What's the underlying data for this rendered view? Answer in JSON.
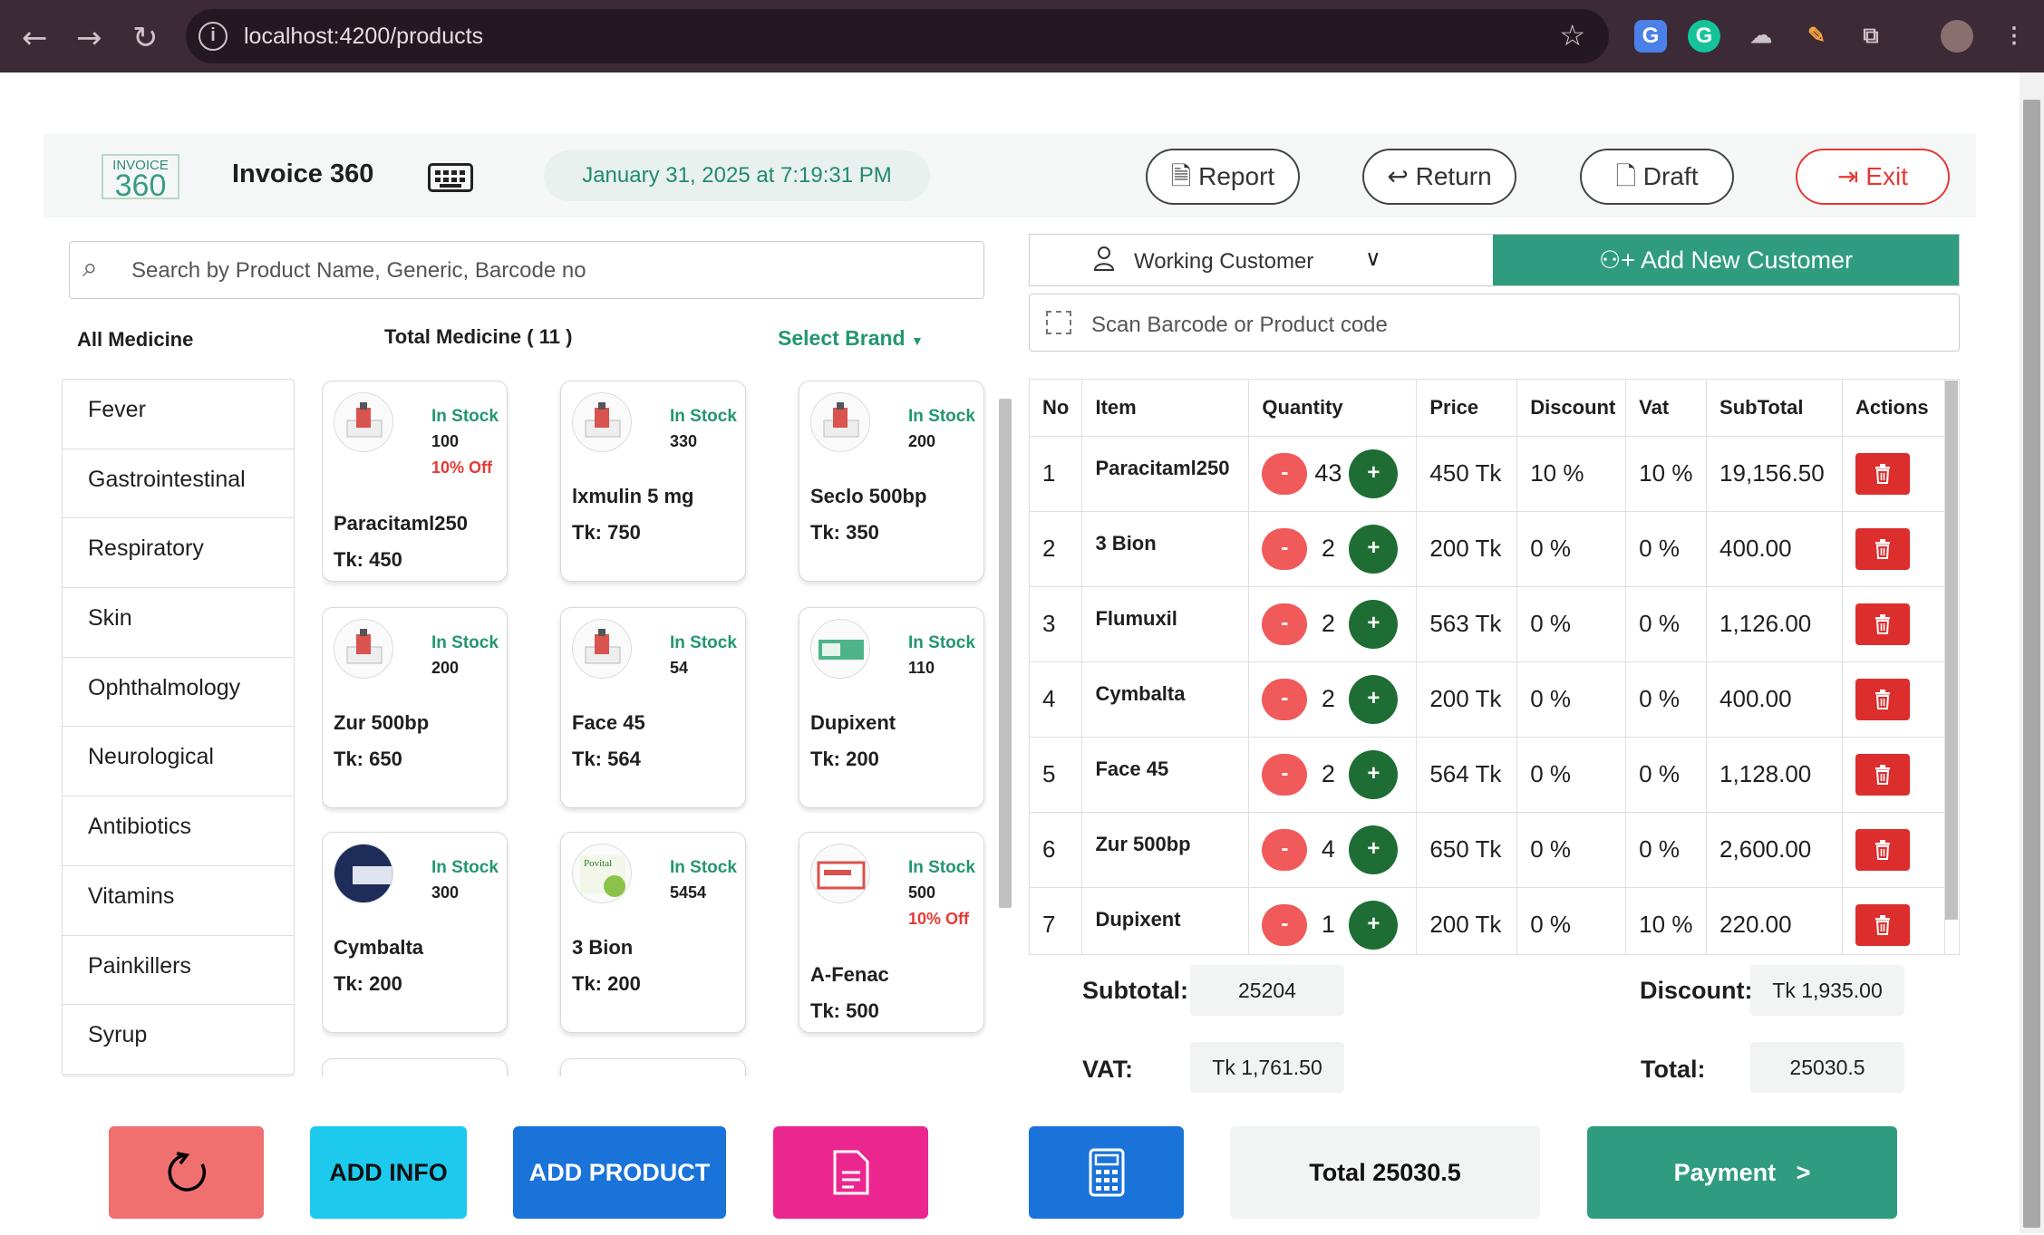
{
  "browser": {
    "url": "localhost:4200/products"
  },
  "header": {
    "logo_top": "INVOICE",
    "logo_num": "360",
    "title": "Invoice 360",
    "datetime": "January 31, 2025 at 7:19:31 PM",
    "report": "Report",
    "return": "Return",
    "draft": "Draft",
    "exit": "Exit"
  },
  "search": {
    "placeholder": "Search by Product Name, Generic, Barcode no"
  },
  "filters": {
    "all_medicine": "All Medicine",
    "total_medicine": "Total Medicine ( 11 )",
    "select_brand": "Select Brand"
  },
  "categories": [
    "Fever",
    "Gastrointestinal",
    "Respiratory",
    "Skin",
    "Ophthalmology",
    "Neurological",
    "Antibiotics",
    "Vitamins",
    "Painkillers",
    "Syrup"
  ],
  "products": [
    {
      "name": "Paracitaml250",
      "price": "Tk: 450",
      "stock": "In Stock",
      "qty": "100",
      "offer": "10% Off"
    },
    {
      "name": "lxmulin 5 mg",
      "price": "Tk: 750",
      "stock": "In Stock",
      "qty": "330",
      "offer": ""
    },
    {
      "name": "Seclo 500bp",
      "price": "Tk: 350",
      "stock": "In Stock",
      "qty": "200",
      "offer": ""
    },
    {
      "name": "Zur 500bp",
      "price": "Tk: 650",
      "stock": "In Stock",
      "qty": "200",
      "offer": ""
    },
    {
      "name": "Face 45",
      "price": "Tk: 564",
      "stock": "In Stock",
      "qty": "54",
      "offer": ""
    },
    {
      "name": "Dupixent",
      "price": "Tk: 200",
      "stock": "In Stock",
      "qty": "110",
      "offer": ""
    },
    {
      "name": "Cymbalta",
      "price": "Tk: 200",
      "stock": "In Stock",
      "qty": "300",
      "offer": ""
    },
    {
      "name": "3 Bion",
      "price": "Tk: 200",
      "stock": "In Stock",
      "qty": "5454",
      "offer": ""
    },
    {
      "name": "A-Fenac",
      "price": "Tk: 500",
      "stock": "In Stock",
      "qty": "500",
      "offer": "10% Off"
    }
  ],
  "customer": {
    "working": "Working Customer",
    "add_new": "Add New Customer"
  },
  "scan": {
    "placeholder": "Scan Barcode or Product code"
  },
  "cart": {
    "columns": [
      "No",
      "Item",
      "Quantity",
      "Price",
      "Discount",
      "Vat",
      "SubTotal",
      "Actions"
    ],
    "rows": [
      {
        "no": "1",
        "item": "Paracitaml250",
        "qty": "43",
        "price": "450 Tk",
        "discount": "10 %",
        "vat": "10 %",
        "subtotal": "19,156.50"
      },
      {
        "no": "2",
        "item": "3 Bion",
        "qty": "2",
        "price": "200 Tk",
        "discount": "0 %",
        "vat": "0 %",
        "subtotal": "400.00"
      },
      {
        "no": "3",
        "item": "Flumuxil",
        "qty": "2",
        "price": "563 Tk",
        "discount": "0 %",
        "vat": "0 %",
        "subtotal": "1,126.00"
      },
      {
        "no": "4",
        "item": "Cymbalta",
        "qty": "2",
        "price": "200 Tk",
        "discount": "0 %",
        "vat": "0 %",
        "subtotal": "400.00"
      },
      {
        "no": "5",
        "item": "Face 45",
        "qty": "2",
        "price": "564 Tk",
        "discount": "0 %",
        "vat": "0 %",
        "subtotal": "1,128.00"
      },
      {
        "no": "6",
        "item": "Zur 500bp",
        "qty": "4",
        "price": "650 Tk",
        "discount": "0 %",
        "vat": "0 %",
        "subtotal": "2,600.00"
      },
      {
        "no": "7",
        "item": "Dupixent",
        "qty": "1",
        "price": "200 Tk",
        "discount": "0 %",
        "vat": "10 %",
        "subtotal": "220.00"
      }
    ]
  },
  "summary": {
    "subtotal_label": "Subtotal:",
    "subtotal": "25204",
    "discount_label": "Discount:",
    "discount": "Tk 1,935.00",
    "vat_label": "VAT:",
    "vat": "Tk 1,761.50",
    "total_label": "Total:",
    "total": "25030.5"
  },
  "footer": {
    "add_info": "ADD INFO",
    "add_product": "ADD PRODUCT",
    "total": "Total 25030.5",
    "payment": "Payment   >"
  },
  "colors": {
    "accent": "#2f9c7f",
    "danger": "#e53935",
    "browser_bar": "#3c2a36"
  }
}
